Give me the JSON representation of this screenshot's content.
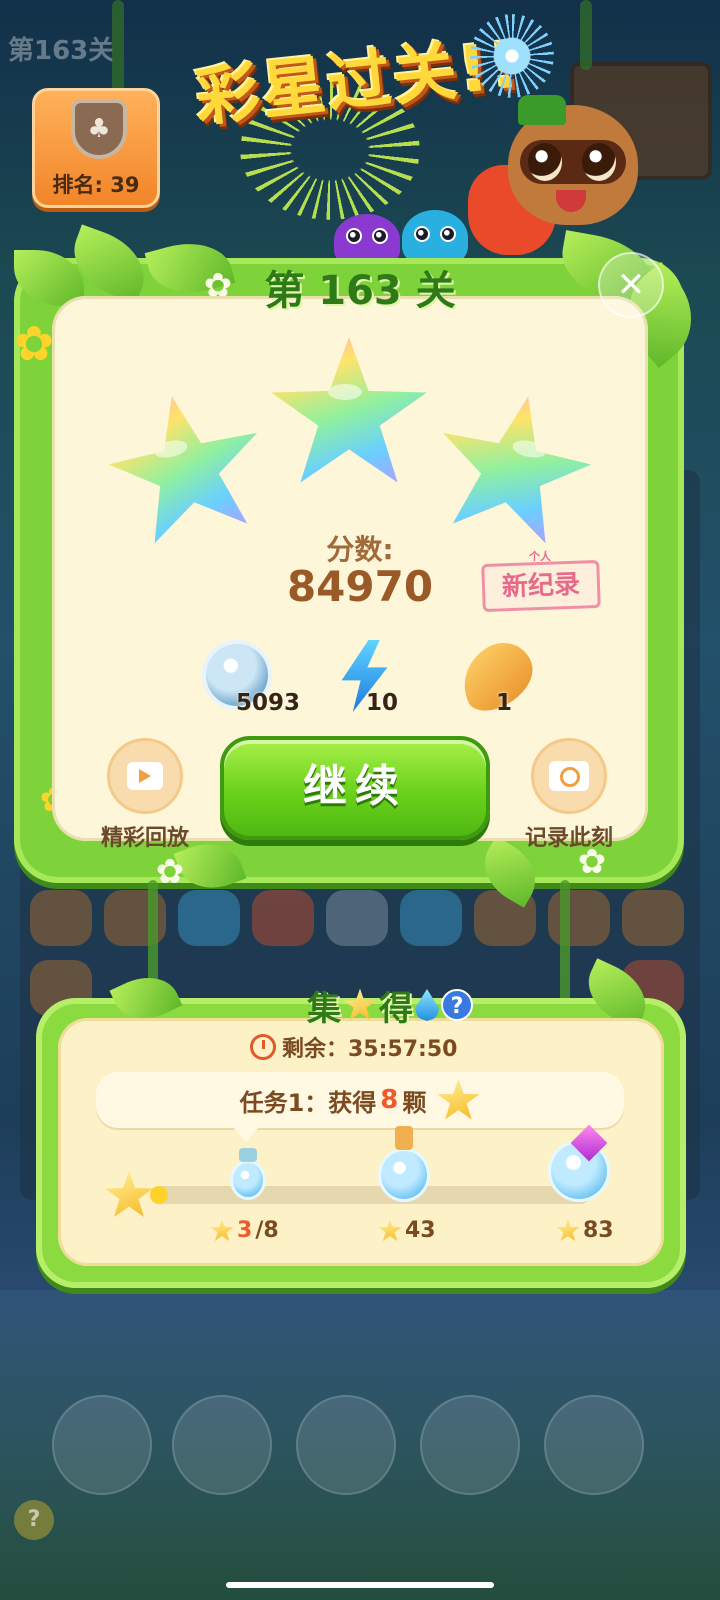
{
  "background": {
    "level_text": "第163关"
  },
  "rank": {
    "label": "排名: 39",
    "badge_icon": "clover-shield"
  },
  "banner": {
    "title": "彩星过关!!"
  },
  "level_panel": {
    "title": "第 163 关",
    "stars_earned": 3,
    "stars_total": 3,
    "score_label": "分数:",
    "score_value": "84970",
    "record_small": "个人",
    "record_label": "新纪录",
    "rewards": [
      {
        "icon": "coin-icon",
        "count": "5093"
      },
      {
        "icon": "lightning-icon",
        "count": "10"
      },
      {
        "icon": "seed-icon",
        "count": "1"
      }
    ],
    "replay_label": "精彩回放",
    "capture_label": "记录此刻",
    "continue_label": "继续",
    "close_symbol": "✕"
  },
  "event": {
    "title_parts": [
      "集",
      "得"
    ],
    "help_symbol": "?",
    "timer_label": "剩余：35:57:50",
    "task_prefix": "任务1：获得",
    "task_count": "8",
    "task_suffix": "颗",
    "progress": 0.0,
    "milestones": [
      {
        "current": "3",
        "target": "/8"
      },
      {
        "current": "",
        "target": "43"
      },
      {
        "current": "",
        "target": "83"
      }
    ]
  },
  "dock": {
    "help_symbol": "?"
  },
  "colors": {
    "panel_green": "#7ed23a",
    "panel_cream": "#fdf6d8",
    "continue_green": "#6ad21a",
    "score_brown": "#9a5a28",
    "record_pink": "#e86a8a"
  }
}
